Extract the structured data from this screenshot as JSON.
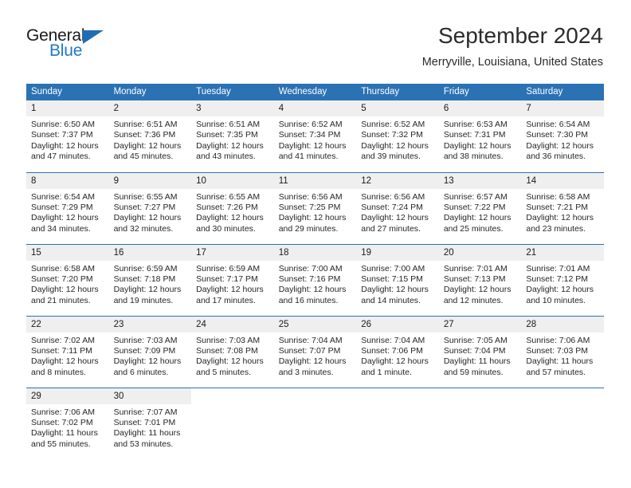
{
  "brand": {
    "name_top": "General",
    "name_bottom": "Blue",
    "triangle_color": "#1f6eb5",
    "text_color": "#1f7ac4"
  },
  "header": {
    "title": "September 2024",
    "subtitle": "Merryville, Louisiana, United States"
  },
  "theme": {
    "header_bg": "#2b72b4",
    "daynum_bg": "#efefef",
    "grid_line": "#2b72b4",
    "text": "#262626"
  },
  "weekdays": [
    "Sunday",
    "Monday",
    "Tuesday",
    "Wednesday",
    "Thursday",
    "Friday",
    "Saturday"
  ],
  "weeks": [
    [
      {
        "day": "1",
        "sunrise": "Sunrise: 6:50 AM",
        "sunset": "Sunset: 7:37 PM",
        "daylight1": "Daylight: 12 hours",
        "daylight2": "and 47 minutes."
      },
      {
        "day": "2",
        "sunrise": "Sunrise: 6:51 AM",
        "sunset": "Sunset: 7:36 PM",
        "daylight1": "Daylight: 12 hours",
        "daylight2": "and 45 minutes."
      },
      {
        "day": "3",
        "sunrise": "Sunrise: 6:51 AM",
        "sunset": "Sunset: 7:35 PM",
        "daylight1": "Daylight: 12 hours",
        "daylight2": "and 43 minutes."
      },
      {
        "day": "4",
        "sunrise": "Sunrise: 6:52 AM",
        "sunset": "Sunset: 7:34 PM",
        "daylight1": "Daylight: 12 hours",
        "daylight2": "and 41 minutes."
      },
      {
        "day": "5",
        "sunrise": "Sunrise: 6:52 AM",
        "sunset": "Sunset: 7:32 PM",
        "daylight1": "Daylight: 12 hours",
        "daylight2": "and 39 minutes."
      },
      {
        "day": "6",
        "sunrise": "Sunrise: 6:53 AM",
        "sunset": "Sunset: 7:31 PM",
        "daylight1": "Daylight: 12 hours",
        "daylight2": "and 38 minutes."
      },
      {
        "day": "7",
        "sunrise": "Sunrise: 6:54 AM",
        "sunset": "Sunset: 7:30 PM",
        "daylight1": "Daylight: 12 hours",
        "daylight2": "and 36 minutes."
      }
    ],
    [
      {
        "day": "8",
        "sunrise": "Sunrise: 6:54 AM",
        "sunset": "Sunset: 7:29 PM",
        "daylight1": "Daylight: 12 hours",
        "daylight2": "and 34 minutes."
      },
      {
        "day": "9",
        "sunrise": "Sunrise: 6:55 AM",
        "sunset": "Sunset: 7:27 PM",
        "daylight1": "Daylight: 12 hours",
        "daylight2": "and 32 minutes."
      },
      {
        "day": "10",
        "sunrise": "Sunrise: 6:55 AM",
        "sunset": "Sunset: 7:26 PM",
        "daylight1": "Daylight: 12 hours",
        "daylight2": "and 30 minutes."
      },
      {
        "day": "11",
        "sunrise": "Sunrise: 6:56 AM",
        "sunset": "Sunset: 7:25 PM",
        "daylight1": "Daylight: 12 hours",
        "daylight2": "and 29 minutes."
      },
      {
        "day": "12",
        "sunrise": "Sunrise: 6:56 AM",
        "sunset": "Sunset: 7:24 PM",
        "daylight1": "Daylight: 12 hours",
        "daylight2": "and 27 minutes."
      },
      {
        "day": "13",
        "sunrise": "Sunrise: 6:57 AM",
        "sunset": "Sunset: 7:22 PM",
        "daylight1": "Daylight: 12 hours",
        "daylight2": "and 25 minutes."
      },
      {
        "day": "14",
        "sunrise": "Sunrise: 6:58 AM",
        "sunset": "Sunset: 7:21 PM",
        "daylight1": "Daylight: 12 hours",
        "daylight2": "and 23 minutes."
      }
    ],
    [
      {
        "day": "15",
        "sunrise": "Sunrise: 6:58 AM",
        "sunset": "Sunset: 7:20 PM",
        "daylight1": "Daylight: 12 hours",
        "daylight2": "and 21 minutes."
      },
      {
        "day": "16",
        "sunrise": "Sunrise: 6:59 AM",
        "sunset": "Sunset: 7:18 PM",
        "daylight1": "Daylight: 12 hours",
        "daylight2": "and 19 minutes."
      },
      {
        "day": "17",
        "sunrise": "Sunrise: 6:59 AM",
        "sunset": "Sunset: 7:17 PM",
        "daylight1": "Daylight: 12 hours",
        "daylight2": "and 17 minutes."
      },
      {
        "day": "18",
        "sunrise": "Sunrise: 7:00 AM",
        "sunset": "Sunset: 7:16 PM",
        "daylight1": "Daylight: 12 hours",
        "daylight2": "and 16 minutes."
      },
      {
        "day": "19",
        "sunrise": "Sunrise: 7:00 AM",
        "sunset": "Sunset: 7:15 PM",
        "daylight1": "Daylight: 12 hours",
        "daylight2": "and 14 minutes."
      },
      {
        "day": "20",
        "sunrise": "Sunrise: 7:01 AM",
        "sunset": "Sunset: 7:13 PM",
        "daylight1": "Daylight: 12 hours",
        "daylight2": "and 12 minutes."
      },
      {
        "day": "21",
        "sunrise": "Sunrise: 7:01 AM",
        "sunset": "Sunset: 7:12 PM",
        "daylight1": "Daylight: 12 hours",
        "daylight2": "and 10 minutes."
      }
    ],
    [
      {
        "day": "22",
        "sunrise": "Sunrise: 7:02 AM",
        "sunset": "Sunset: 7:11 PM",
        "daylight1": "Daylight: 12 hours",
        "daylight2": "and 8 minutes."
      },
      {
        "day": "23",
        "sunrise": "Sunrise: 7:03 AM",
        "sunset": "Sunset: 7:09 PM",
        "daylight1": "Daylight: 12 hours",
        "daylight2": "and 6 minutes."
      },
      {
        "day": "24",
        "sunrise": "Sunrise: 7:03 AM",
        "sunset": "Sunset: 7:08 PM",
        "daylight1": "Daylight: 12 hours",
        "daylight2": "and 5 minutes."
      },
      {
        "day": "25",
        "sunrise": "Sunrise: 7:04 AM",
        "sunset": "Sunset: 7:07 PM",
        "daylight1": "Daylight: 12 hours",
        "daylight2": "and 3 minutes."
      },
      {
        "day": "26",
        "sunrise": "Sunrise: 7:04 AM",
        "sunset": "Sunset: 7:06 PM",
        "daylight1": "Daylight: 12 hours",
        "daylight2": "and 1 minute."
      },
      {
        "day": "27",
        "sunrise": "Sunrise: 7:05 AM",
        "sunset": "Sunset: 7:04 PM",
        "daylight1": "Daylight: 11 hours",
        "daylight2": "and 59 minutes."
      },
      {
        "day": "28",
        "sunrise": "Sunrise: 7:06 AM",
        "sunset": "Sunset: 7:03 PM",
        "daylight1": "Daylight: 11 hours",
        "daylight2": "and 57 minutes."
      }
    ],
    [
      {
        "day": "29",
        "sunrise": "Sunrise: 7:06 AM",
        "sunset": "Sunset: 7:02 PM",
        "daylight1": "Daylight: 11 hours",
        "daylight2": "and 55 minutes."
      },
      {
        "day": "30",
        "sunrise": "Sunrise: 7:07 AM",
        "sunset": "Sunset: 7:01 PM",
        "daylight1": "Daylight: 11 hours",
        "daylight2": "and 53 minutes."
      },
      {
        "day": "",
        "sunrise": "",
        "sunset": "",
        "daylight1": "",
        "daylight2": ""
      },
      {
        "day": "",
        "sunrise": "",
        "sunset": "",
        "daylight1": "",
        "daylight2": ""
      },
      {
        "day": "",
        "sunrise": "",
        "sunset": "",
        "daylight1": "",
        "daylight2": ""
      },
      {
        "day": "",
        "sunrise": "",
        "sunset": "",
        "daylight1": "",
        "daylight2": ""
      },
      {
        "day": "",
        "sunrise": "",
        "sunset": "",
        "daylight1": "",
        "daylight2": ""
      }
    ]
  ]
}
